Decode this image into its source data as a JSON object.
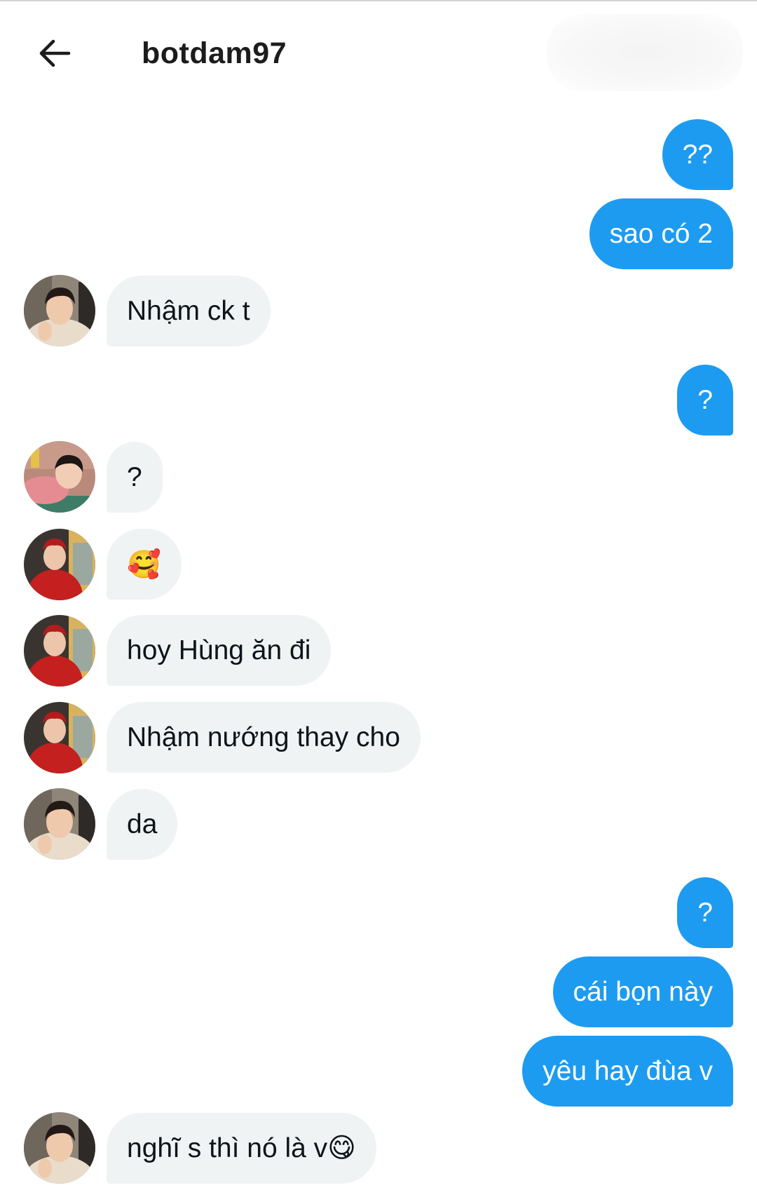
{
  "header": {
    "title": "botdam97",
    "back_icon": "arrow-left-icon"
  },
  "colors": {
    "outgoing_bubble": "#1d9bf0",
    "incoming_bubble": "#eff3f4"
  },
  "messages": [
    {
      "dir": "out",
      "text": "??"
    },
    {
      "dir": "out",
      "text": "sao có 2"
    },
    {
      "dir": "in",
      "avatar": "avatar-beige-jacket",
      "text": "Nhậm ck t"
    },
    {
      "dir": "out",
      "text": "?"
    },
    {
      "dir": "in",
      "avatar": "avatar-pink-sweater",
      "text": "?"
    },
    {
      "dir": "in",
      "avatar": "avatar-red-jacket",
      "text": "🥰"
    },
    {
      "dir": "in",
      "avatar": "avatar-red-jacket",
      "text": "hoy Hùng ăn đi"
    },
    {
      "dir": "in",
      "avatar": "avatar-red-jacket",
      "text": "Nhậm nướng thay cho"
    },
    {
      "dir": "in",
      "avatar": "avatar-beige-jacket",
      "text": "da"
    },
    {
      "dir": "out",
      "text": "?"
    },
    {
      "dir": "out",
      "text": "cái bọn này"
    },
    {
      "dir": "out",
      "text": "yêu hay đùa v"
    },
    {
      "dir": "in",
      "avatar": "avatar-beige-jacket",
      "text": "nghĩ s thì nó là v😋"
    }
  ]
}
